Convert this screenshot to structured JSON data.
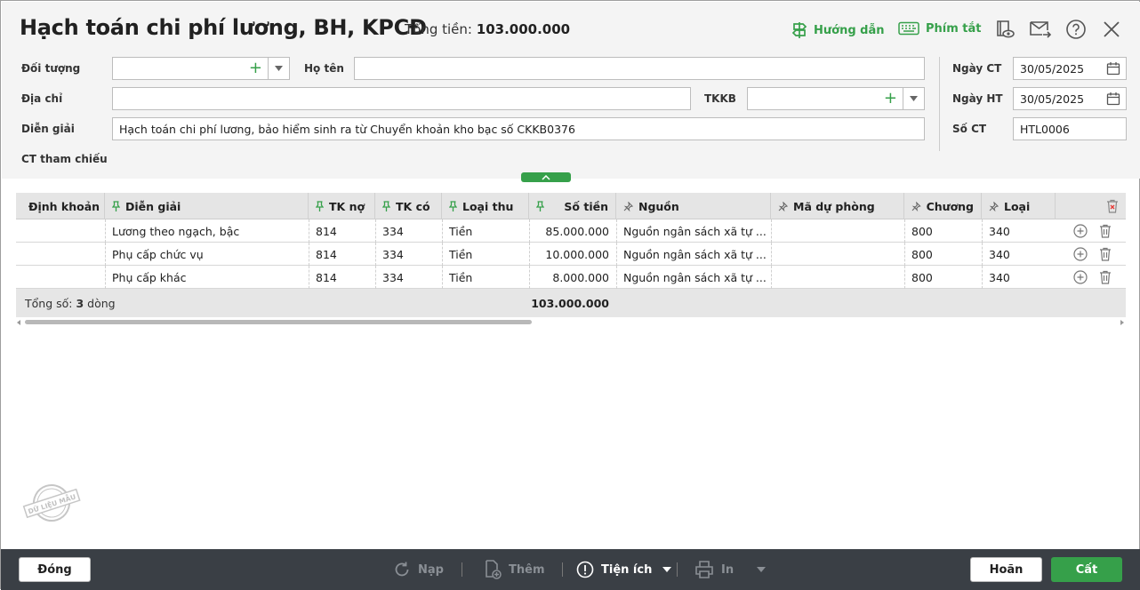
{
  "header": {
    "title": "Hạch toán chi phí lương, BH, KPCĐ",
    "total_label": "Tổng tiền:",
    "total_value": "103.000.000",
    "guide_label": "Hướng dẫn",
    "shortcut_label": "Phím tắt"
  },
  "form": {
    "object_label": "Đối tượng",
    "object_value": "",
    "name_label": "Họ tên",
    "name_value": "",
    "address_label": "Địa chỉ",
    "address_value": "",
    "tkkb_label": "TKKB",
    "tkkb_value": "",
    "desc_label": "Diễn giải",
    "desc_value": "Hạch toán chi phí lương, bảo hiểm sinh ra từ Chuyển khoản kho bạc số CKKB0376",
    "ref_label": "CT tham chiếu",
    "doc_date_label": "Ngày CT",
    "doc_date_value": "30/05/2025",
    "post_date_label": "Ngày HT",
    "post_date_value": "30/05/2025",
    "doc_no_label": "Số CT",
    "doc_no_value": "HTL0006"
  },
  "table": {
    "columns": [
      "Định khoản",
      "Diễn giải",
      "TK nợ",
      "TK có",
      "Loại thu",
      "Số tiền",
      "Nguồn",
      "Mã dự phòng",
      "Chương",
      "Loại"
    ],
    "rows": [
      {
        "dinh_khoan": "",
        "dien_giai": "Lương theo ngạch, bậc",
        "tk_no": "814",
        "tk_co": "334",
        "loai_thu": "Tiền",
        "so_tien": "85.000.000",
        "nguon": "Nguồn ngân sách xã tự ...",
        "ma_du_phong": "",
        "chuong": "800",
        "loai": "340"
      },
      {
        "dinh_khoan": "",
        "dien_giai": "Phụ cấp chức vụ",
        "tk_no": "814",
        "tk_co": "334",
        "loai_thu": "Tiền",
        "so_tien": "10.000.000",
        "nguon": "Nguồn ngân sách xã tự ...",
        "ma_du_phong": "",
        "chuong": "800",
        "loai": "340"
      },
      {
        "dinh_khoan": "",
        "dien_giai": "Phụ cấp khác",
        "tk_no": "814",
        "tk_co": "334",
        "loai_thu": "Tiền",
        "so_tien": "8.000.000",
        "nguon": "Nguồn ngân sách xã tự ...",
        "ma_du_phong": "",
        "chuong": "800",
        "loai": "340"
      }
    ],
    "footer_prefix": "Tổng số:",
    "footer_count": "3",
    "footer_suffix": "dòng",
    "footer_total": "103.000.000"
  },
  "watermark": "DỮ LIỆU MẪU",
  "toolbar": {
    "close_label": "Đóng",
    "reload_label": "Nạp",
    "add_label": "Thêm",
    "utility_label": "Tiện ích",
    "print_label": "In",
    "cancel_label": "Hoãn",
    "save_label": "Cất"
  },
  "colors": {
    "accent": "#36a04a",
    "toolbar_bg": "#3a3f45",
    "header_bg": "#f4f4f4"
  }
}
